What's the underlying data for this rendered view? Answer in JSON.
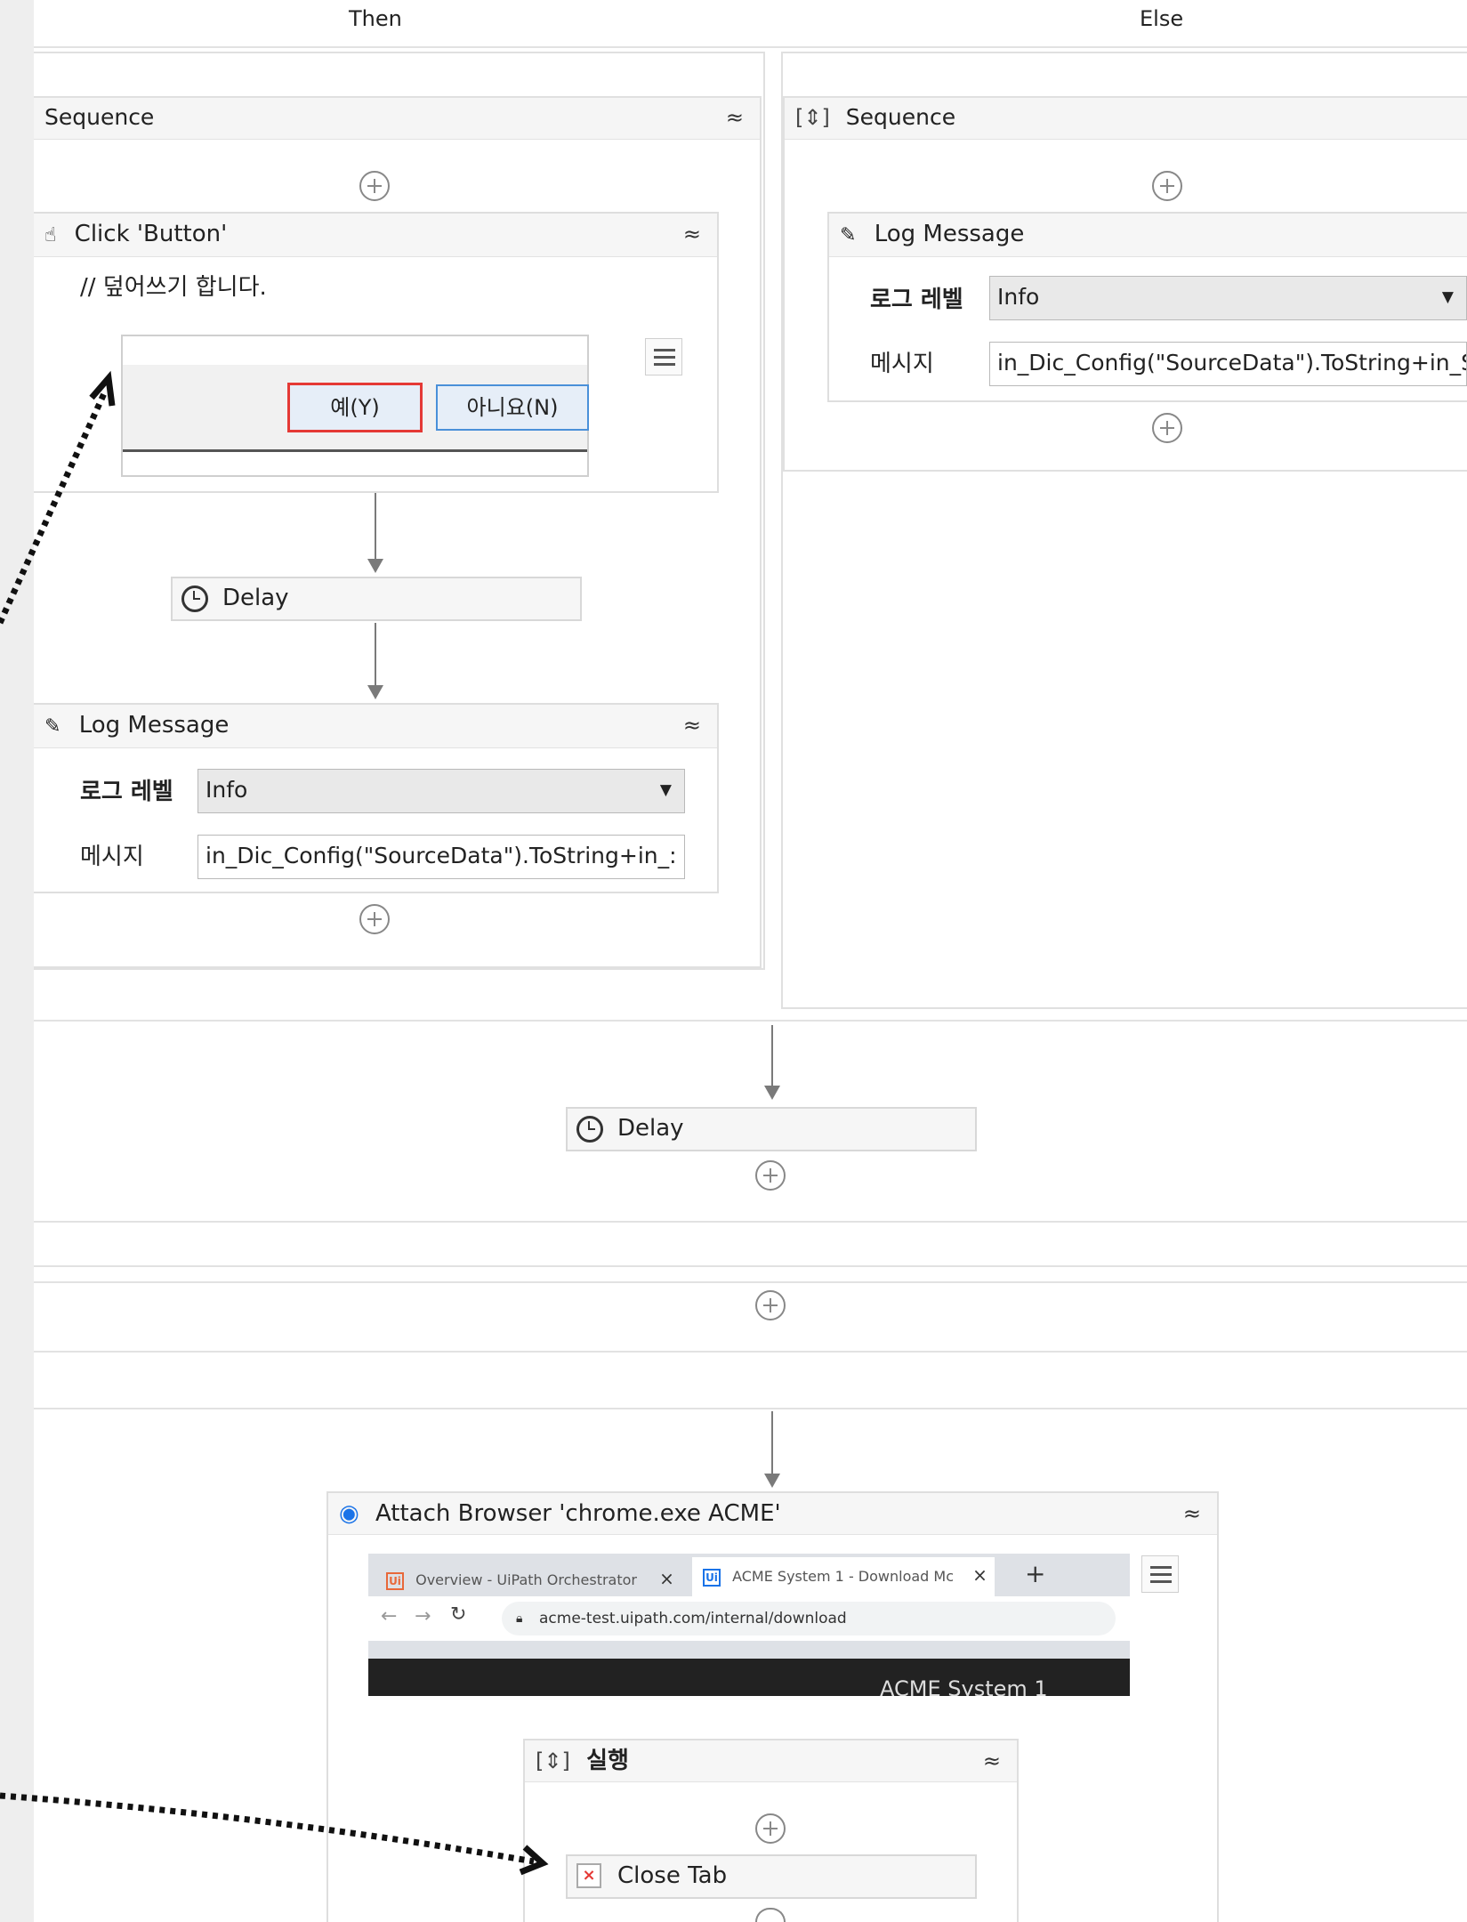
{
  "branches": {
    "then": "Then",
    "else": "Else"
  },
  "then_sequence": {
    "title": "Sequence",
    "click": {
      "title": "Click 'Button'",
      "comment": "// 덮어쓰기 합니다.",
      "yes_button": "예(Y)",
      "no_button": "아니요(N)"
    },
    "delay": "Delay",
    "log": {
      "title": "Log Message",
      "level_label": "로그 레벨",
      "level_value": "Info",
      "message_label": "메시지",
      "message_value": "in_Dic_Config(\"SourceData\").ToString+in_:"
    }
  },
  "else_sequence": {
    "title": "Sequence",
    "log": {
      "title": "Log Message",
      "level_label": "로그 레벨",
      "level_value": "Info",
      "message_label": "메시지",
      "message_value": "in_Dic_Config(\"SourceData\").ToString+in_S"
    }
  },
  "delay_main": "Delay",
  "attach_browser": {
    "title": "Attach Browser 'chrome.exe ACME'",
    "tab1": "Overview - UiPath Orchestrator",
    "tab2": "ACME System 1 - Download Mc",
    "tab_badge": "Ui",
    "tab_close": "×",
    "new_tab": "+",
    "url": "acme-test.uipath.com/internal/download",
    "page_banner": "ACME System 1",
    "do_sequence": {
      "title": "실행",
      "close_tab": "Close Tab"
    }
  },
  "colors": {
    "accent_red": "#e53935",
    "accent_blue": "#1a73e8",
    "annotation": "#111111"
  }
}
